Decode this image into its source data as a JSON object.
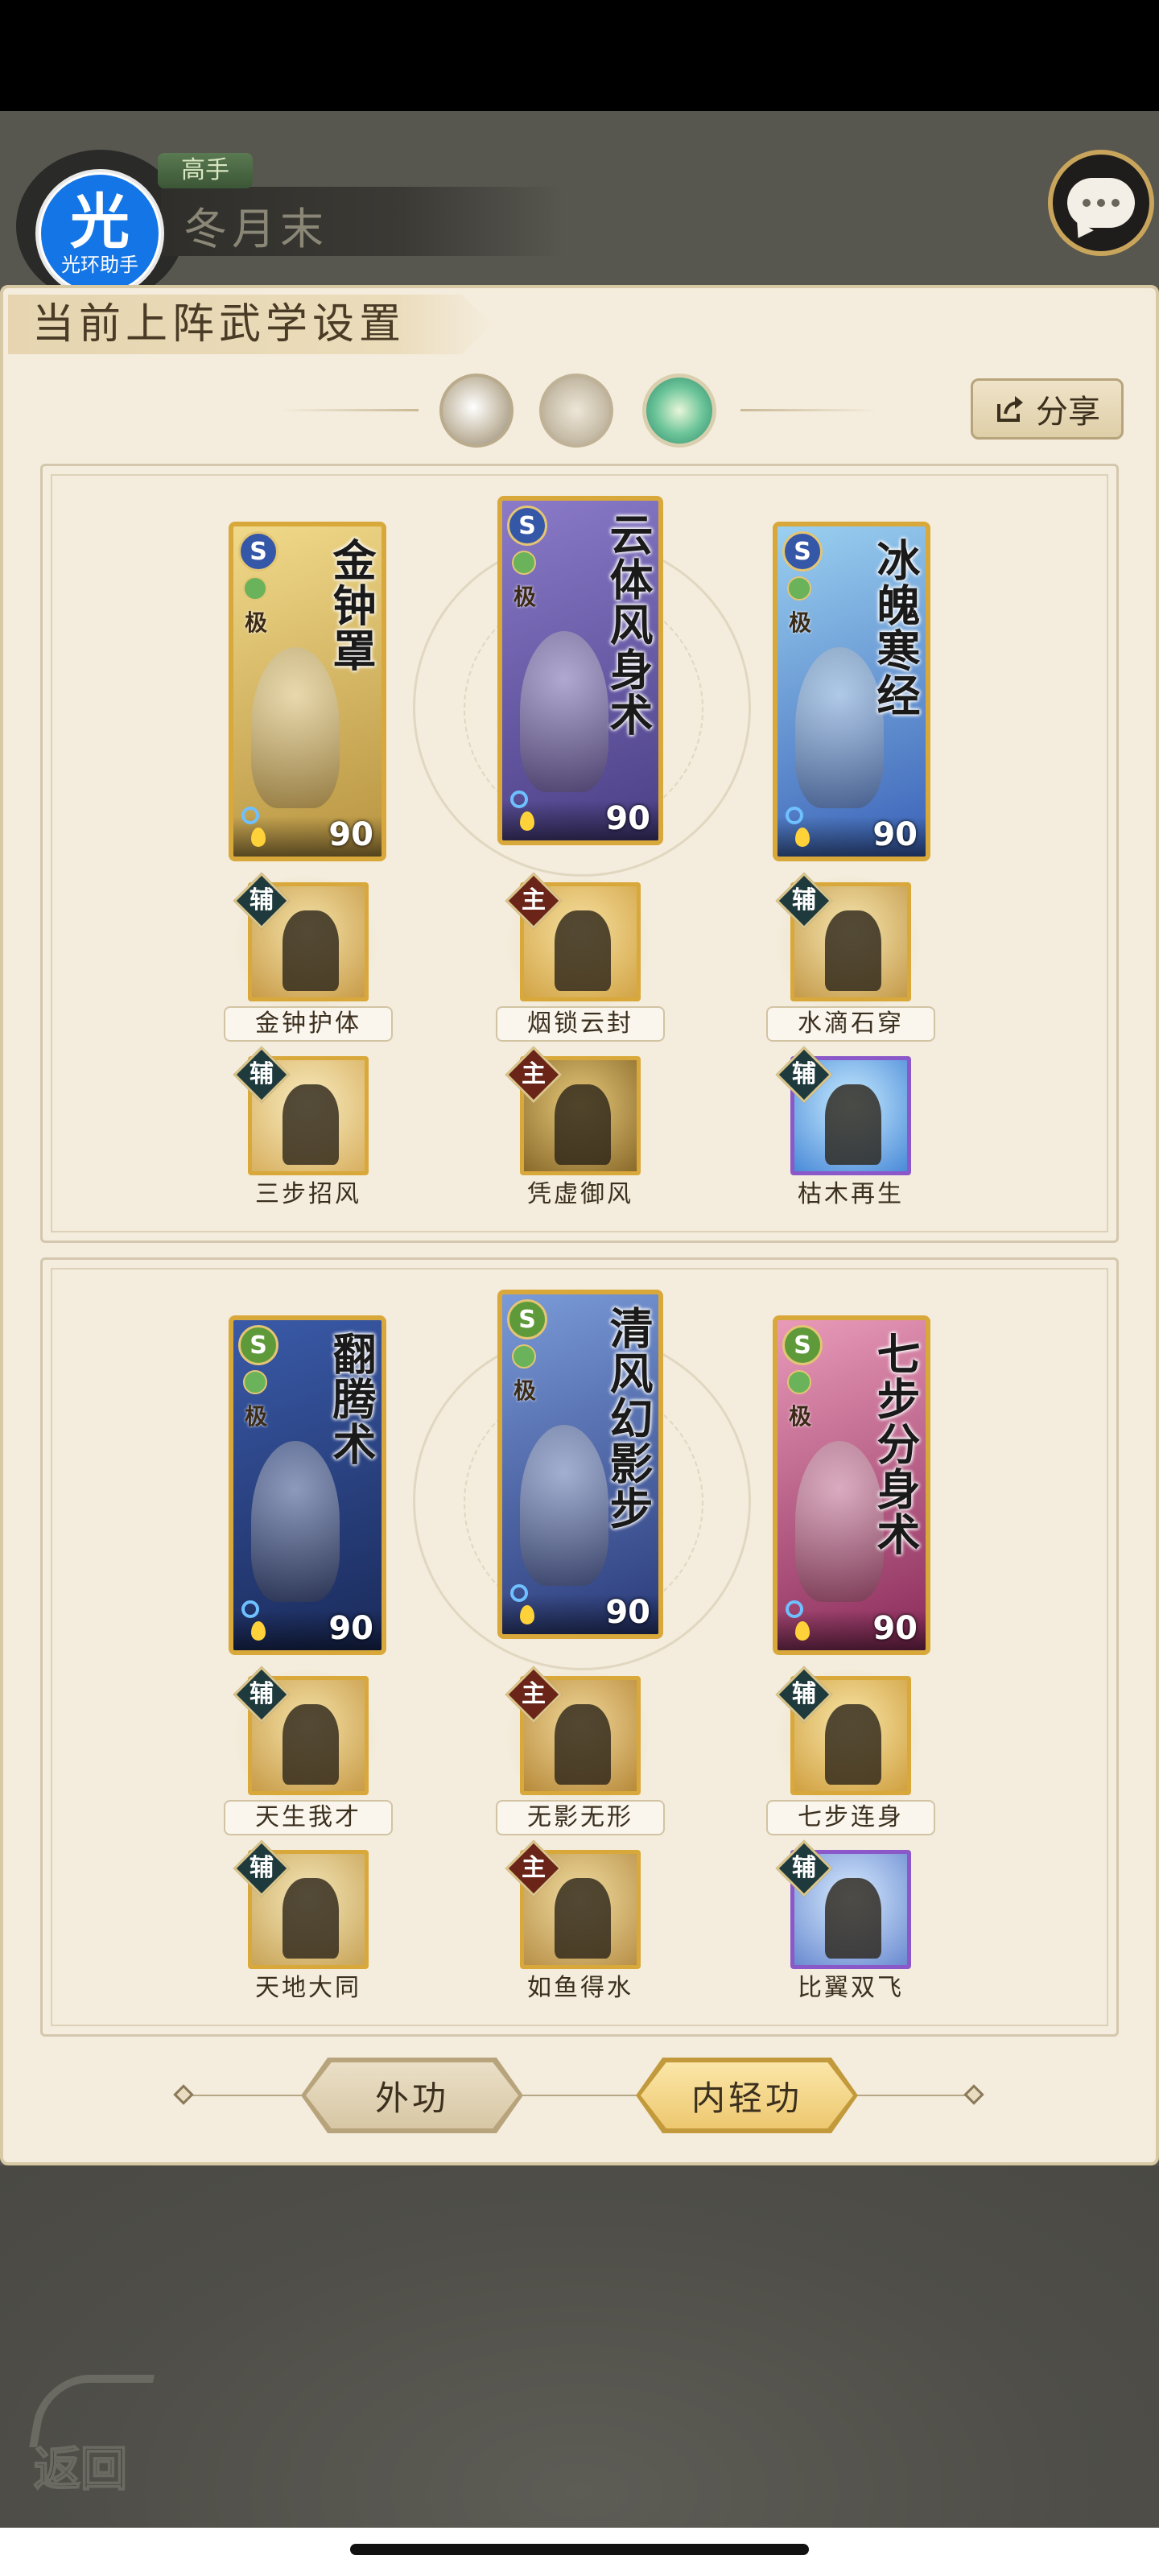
{
  "app_badge": {
    "glyph": "光",
    "label": "光环助手"
  },
  "player": {
    "rank": "高手",
    "name": "冬月末"
  },
  "panel": {
    "title": "当前上阵武学设置"
  },
  "share_button": {
    "label": "分享",
    "icon": "share-icon"
  },
  "page_selector": {
    "pages": [
      {
        "icon": "moon-icon",
        "selected": false
      },
      {
        "icon": "sun-icon",
        "selected": false
      },
      {
        "icon": "leaf-icon",
        "selected": true
      }
    ]
  },
  "sets": [
    {
      "cards": [
        {
          "name": "金钟罩",
          "school": "S",
          "tier": "极",
          "level": "90",
          "art_colors": [
            "#f0d98a",
            "#b89440"
          ]
        },
        {
          "name": "云体风身术",
          "school": "S",
          "tier": "极",
          "level": "90",
          "art_colors": [
            "#8a7ac8",
            "#4a3f86"
          ]
        },
        {
          "name": "冰魄寒经",
          "school": "S",
          "tier": "极",
          "level": "90",
          "art_colors": [
            "#9ad0f0",
            "#3a62b8"
          ]
        }
      ],
      "subs": [
        {
          "name": "金钟护体",
          "role": "辅",
          "frame": "gold",
          "colors": [
            "#f4e2a8",
            "#c89b48"
          ]
        },
        {
          "name": "烟锁云封",
          "role": "主",
          "frame": "gold",
          "colors": [
            "#f6e0a0",
            "#d2a446"
          ]
        },
        {
          "name": "水滴石穿",
          "role": "辅",
          "frame": "gold",
          "colors": [
            "#f6e6b0",
            "#c49a4a"
          ]
        },
        {
          "name": "三步招风",
          "role": "辅",
          "frame": "gold",
          "colors": [
            "#f8ecc0",
            "#d8b060"
          ]
        },
        {
          "name": "凭虚御风",
          "role": "主",
          "frame": "gold",
          "colors": [
            "#e6c87a",
            "#8a6a2a"
          ]
        },
        {
          "name": "枯木再生",
          "role": "辅",
          "frame": "purple",
          "colors": [
            "#c8ecff",
            "#4a8ad8"
          ]
        }
      ]
    },
    {
      "cards": [
        {
          "name": "翻腾术",
          "school": "S",
          "tier": "极",
          "level": "90",
          "art_colors": [
            "#3a5aa8",
            "#1a2a5a"
          ]
        },
        {
          "name": "清风幻影步",
          "school": "S",
          "tier": "极",
          "level": "90",
          "art_colors": [
            "#7a9ad8",
            "#2a3a7a"
          ]
        },
        {
          "name": "七步分身术",
          "school": "S",
          "tier": "极",
          "level": "90",
          "art_colors": [
            "#e89ab8",
            "#8a2a5a"
          ]
        }
      ],
      "subs": [
        {
          "name": "天生我才",
          "role": "辅",
          "frame": "gold",
          "colors": [
            "#f4e2a8",
            "#c89b48"
          ]
        },
        {
          "name": "无影无形",
          "role": "主",
          "frame": "gold",
          "colors": [
            "#f0d79a",
            "#b88a3a"
          ]
        },
        {
          "name": "七步连身",
          "role": "辅",
          "frame": "gold",
          "colors": [
            "#f8e6a8",
            "#d0a040"
          ]
        },
        {
          "name": "天地大同",
          "role": "辅",
          "frame": "gold",
          "colors": [
            "#f4e6b8",
            "#c8a458"
          ]
        },
        {
          "name": "如鱼得水",
          "role": "主",
          "frame": "gold",
          "colors": [
            "#f0dca0",
            "#b89048"
          ]
        },
        {
          "name": "比翼双飞",
          "role": "辅",
          "frame": "purple",
          "colors": [
            "#d8ecff",
            "#6a8ad0"
          ]
        }
      ]
    }
  ],
  "tabs": {
    "outer": "外功",
    "inner": "内轻功",
    "selected": "inner"
  },
  "back_button": {
    "label": "返回"
  }
}
